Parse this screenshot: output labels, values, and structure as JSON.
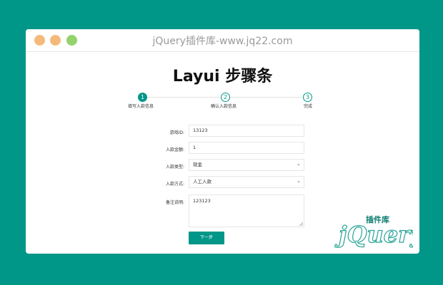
{
  "window": {
    "title": "jQuery插件库-www.jq22.com"
  },
  "page": {
    "title": "Layui 步骤条"
  },
  "steps": [
    {
      "num": "1",
      "label": "填写入款信息",
      "active": true
    },
    {
      "num": "2",
      "label": "确认入款信息",
      "active": false
    },
    {
      "num": "3",
      "label": "完成",
      "active": false
    }
  ],
  "form": {
    "game_id": {
      "label": "游戏ID:",
      "value": "13123"
    },
    "amount": {
      "label": "入款金额:",
      "value": "1"
    },
    "type": {
      "label": "入款类型:",
      "value": "现金"
    },
    "method": {
      "label": "入款方式:",
      "value": "人工入款"
    },
    "note": {
      "label": "备注说明:",
      "value": "123123"
    }
  },
  "next_button": "下一步",
  "watermark": {
    "text": "jQuery",
    "sub": "插件库"
  },
  "colors": {
    "accent": "#009688",
    "background": "#009688"
  }
}
